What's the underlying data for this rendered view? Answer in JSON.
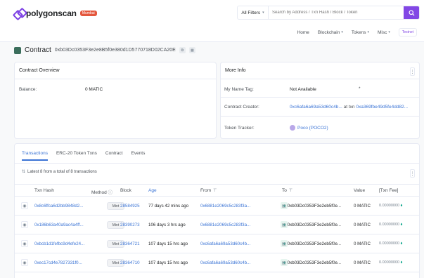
{
  "header": {
    "logo_text": "polygonscan",
    "logo_badge": "Mumbai",
    "filter_label": "All Filters",
    "search_placeholder": "Search by Address / Txn Hash / Block / Token",
    "nav": [
      {
        "label": "Home"
      },
      {
        "label": "Blockchain"
      },
      {
        "label": "Tokens"
      },
      {
        "label": "Misc"
      }
    ],
    "testnet_label": "Testnet"
  },
  "contract": {
    "label": "Contract",
    "address": "0xb03Dc0353F3e2e8B5f0e380d1D5770718D02CA20E"
  },
  "overview": {
    "title": "Contract Overview",
    "balance_label": "Balance:",
    "balance_value": "0 MATIC"
  },
  "more_info": {
    "title": "More Info",
    "name_tag_label": "My Name Tag:",
    "name_tag_value": "Not Available",
    "name_tag_mark": "*",
    "creator_label": "Contract Creator:",
    "creator_address": "0xc6afa6a69a53d60c4b...",
    "creator_at_txn": "at txn",
    "creator_txn": "0xa369fbe49d5fe4dd82...",
    "token_tracker_label": "Token Tracker:",
    "token_tracker_value": "Poco (POCO2)"
  },
  "tabs": [
    {
      "label": "Transactions",
      "active": true
    },
    {
      "label": "ERC-20 Token Txns",
      "active": false
    },
    {
      "label": "Contract",
      "active": false
    },
    {
      "label": "Events",
      "active": false
    }
  ],
  "latest_text": "Latest 8 from a total of 8 transactions",
  "table": {
    "headers": {
      "txn_hash": "Txn Hash",
      "method": "Method",
      "block": "Block",
      "age": "Age",
      "from": "From",
      "to": "To",
      "value": "Value",
      "fee": "[Txn Fee]"
    },
    "rows": [
      {
        "hash": "0x8c6ffca6d2bb9848d2...",
        "method": "Mint",
        "block": "28584925",
        "age": "77 days 42 mins ago",
        "from": "0x6881e2069c5c283f3a...",
        "to": "0xb03Dc0353F3e2eb5f0e...",
        "value": "0 MATIC",
        "fee": "0.00000000"
      },
      {
        "hash": "0x186b63a40a9ac4a4ff...",
        "method": "Mint",
        "block": "28390273",
        "age": "106 days 3 hrs ago",
        "from": "0x6881e2069c5c283f3a...",
        "to": "0xb03Dc0353F3e2eb5f0e...",
        "value": "0 MATIC",
        "fee": "0.00000000"
      },
      {
        "hash": "0xbcb1d1fefbc9d4efe24...",
        "method": "Mint",
        "block": "28364721",
        "age": "107 days 15 hrs ago",
        "from": "0xc6afa6a69a53d60c4b...",
        "to": "0xb03Dc0353F3e2eb5f0e...",
        "value": "0 MATIC",
        "fee": "0.00000000"
      },
      {
        "hash": "0xec17cd4e7827331f0...",
        "method": "Mint",
        "block": "28364710",
        "age": "107 days 15 hrs ago",
        "from": "0xc6afa6a69a53d60c4b...",
        "to": "0xb03Dc0353F3e2eb5f0e...",
        "value": "0 MATIC",
        "fee": "0.00000000"
      }
    ]
  },
  "colors": {
    "brand": "#8247e5",
    "link": "#3b74d5",
    "success": "#00a186"
  }
}
